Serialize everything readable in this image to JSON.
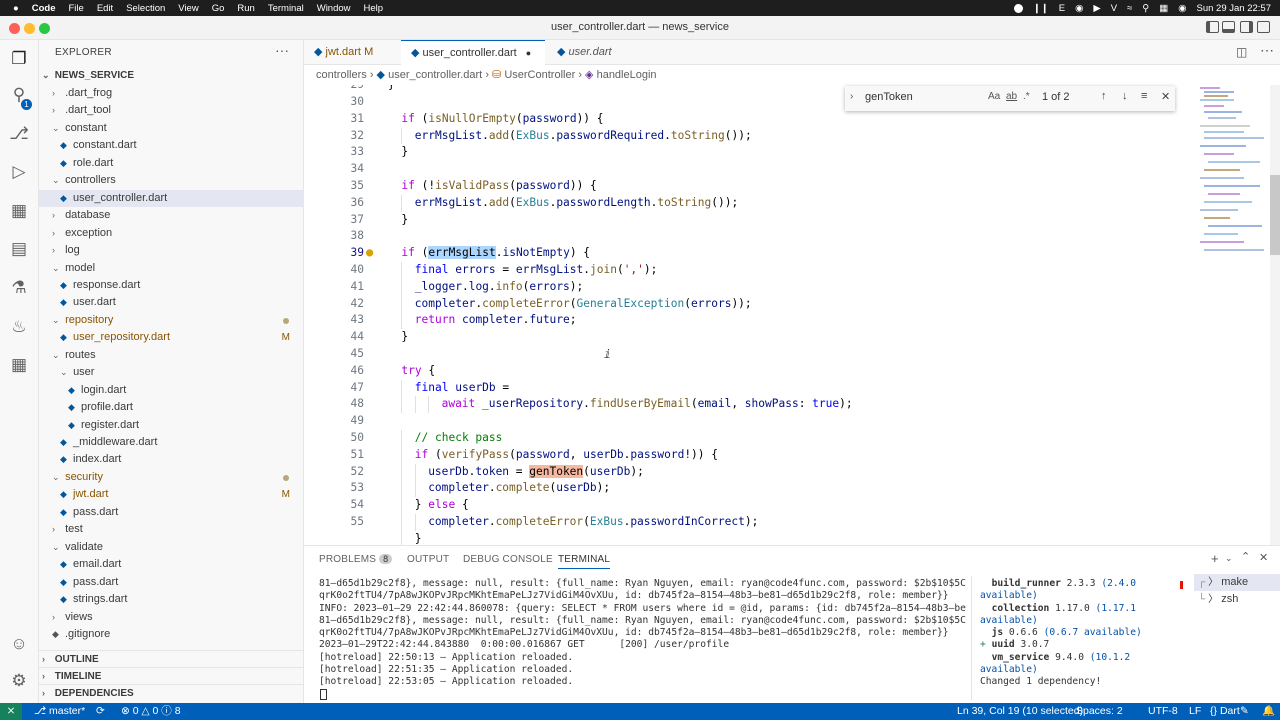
{
  "menubar": {
    "apple": "",
    "app": "Code",
    "items": [
      "File",
      "Edit",
      "Selection",
      "View",
      "Go",
      "Run",
      "Terminal",
      "Window",
      "Help"
    ],
    "clock": "Sun 29 Jan  22:57"
  },
  "window": {
    "title": "user_controller.dart — news_service"
  },
  "activity": {
    "explorer_badge": "1"
  },
  "sidebar": {
    "title": "EXPLORER",
    "more": "···",
    "root": "NEWS_SERVICE",
    "tree": [
      {
        "label": ".dart_frog",
        "depth": 1,
        "kind": "folder",
        "open": false
      },
      {
        "label": ".dart_tool",
        "depth": 1,
        "kind": "folder",
        "open": false
      },
      {
        "label": "constant",
        "depth": 1,
        "kind": "folder",
        "open": true
      },
      {
        "label": "constant.dart",
        "depth": 2,
        "kind": "file"
      },
      {
        "label": "role.dart",
        "depth": 2,
        "kind": "file"
      },
      {
        "label": "controllers",
        "depth": 1,
        "kind": "folder",
        "open": true
      },
      {
        "label": "user_controller.dart",
        "depth": 2,
        "kind": "file",
        "selected": true
      },
      {
        "label": "database",
        "depth": 1,
        "kind": "folder",
        "open": false
      },
      {
        "label": "exception",
        "depth": 1,
        "kind": "folder",
        "open": false
      },
      {
        "label": "log",
        "depth": 1,
        "kind": "folder",
        "open": false
      },
      {
        "label": "model",
        "depth": 1,
        "kind": "folder",
        "open": true
      },
      {
        "label": "response.dart",
        "depth": 2,
        "kind": "file"
      },
      {
        "label": "user.dart",
        "depth": 2,
        "kind": "file"
      },
      {
        "label": "repository",
        "depth": 1,
        "kind": "folder",
        "open": true,
        "modified": true,
        "dot": true
      },
      {
        "label": "user_repository.dart",
        "depth": 2,
        "kind": "file",
        "modified": true,
        "badge": "M"
      },
      {
        "label": "routes",
        "depth": 1,
        "kind": "folder",
        "open": true
      },
      {
        "label": "user",
        "depth": 2,
        "kind": "folder",
        "open": true
      },
      {
        "label": "login.dart",
        "depth": 3,
        "kind": "file"
      },
      {
        "label": "profile.dart",
        "depth": 3,
        "kind": "file"
      },
      {
        "label": "register.dart",
        "depth": 3,
        "kind": "file"
      },
      {
        "label": "_middleware.dart",
        "depth": 2,
        "kind": "file"
      },
      {
        "label": "index.dart",
        "depth": 2,
        "kind": "file"
      },
      {
        "label": "security",
        "depth": 1,
        "kind": "folder",
        "open": true,
        "modified": true,
        "dot": true
      },
      {
        "label": "jwt.dart",
        "depth": 2,
        "kind": "file",
        "modified": true,
        "badge": "M"
      },
      {
        "label": "pass.dart",
        "depth": 2,
        "kind": "file"
      },
      {
        "label": "test",
        "depth": 1,
        "kind": "folder",
        "open": false
      },
      {
        "label": "validate",
        "depth": 1,
        "kind": "folder",
        "open": true
      },
      {
        "label": "email.dart",
        "depth": 2,
        "kind": "file"
      },
      {
        "label": "pass.dart",
        "depth": 2,
        "kind": "file"
      },
      {
        "label": "strings.dart",
        "depth": 2,
        "kind": "file"
      },
      {
        "label": "views",
        "depth": 1,
        "kind": "folder",
        "open": false
      },
      {
        "label": ".gitignore",
        "depth": 1,
        "kind": "gitfile"
      }
    ],
    "sections": [
      "OUTLINE",
      "TIMELINE",
      "DEPENDENCIES"
    ]
  },
  "tabs": [
    {
      "label": "jwt.dart",
      "badge": "M"
    },
    {
      "label": "user_controller.dart",
      "dirty": true
    },
    {
      "label": "user.dart"
    }
  ],
  "breadcrumb": [
    "controllers",
    "user_controller.dart",
    "UserController",
    "handleLogin"
  ],
  "find": {
    "query": "genToken",
    "count": "1 of 2",
    "opt_case": "Aa",
    "opt_word": "ab",
    "opt_regex": ".*"
  },
  "code": {
    "first_partial": "29",
    "lines": [
      {
        "n": "30",
        "indent": 0,
        "segs": []
      },
      {
        "n": "31",
        "indent": 1,
        "segs": [
          [
            "k",
            "if"
          ],
          [
            "p",
            " ("
          ],
          [
            "f",
            "isNullOrEmpty"
          ],
          [
            "p",
            "("
          ],
          [
            "v",
            "password"
          ],
          [
            "p",
            ")) {"
          ]
        ]
      },
      {
        "n": "32",
        "indent": 2,
        "segs": [
          [
            "v",
            "errMsgList"
          ],
          [
            "p",
            "."
          ],
          [
            "f",
            "add"
          ],
          [
            "p",
            "("
          ],
          [
            "t",
            "ExBus"
          ],
          [
            "p",
            "."
          ],
          [
            "v",
            "passwordRequired"
          ],
          [
            "p",
            "."
          ],
          [
            "f",
            "toString"
          ],
          [
            "p",
            "());"
          ]
        ]
      },
      {
        "n": "33",
        "indent": 1,
        "segs": [
          [
            "p",
            "}"
          ]
        ]
      },
      {
        "n": "34",
        "indent": 0,
        "segs": []
      },
      {
        "n": "35",
        "indent": 1,
        "segs": [
          [
            "k",
            "if"
          ],
          [
            "p",
            " (!"
          ],
          [
            "f",
            "isValidPass"
          ],
          [
            "p",
            "("
          ],
          [
            "v",
            "password"
          ],
          [
            "p",
            ")) {"
          ]
        ]
      },
      {
        "n": "36",
        "indent": 2,
        "segs": [
          [
            "v",
            "errMsgList"
          ],
          [
            "p",
            "."
          ],
          [
            "f",
            "add"
          ],
          [
            "p",
            "("
          ],
          [
            "t",
            "ExBus"
          ],
          [
            "p",
            "."
          ],
          [
            "v",
            "passwordLength"
          ],
          [
            "p",
            "."
          ],
          [
            "f",
            "toString"
          ],
          [
            "p",
            "());"
          ]
        ]
      },
      {
        "n": "37",
        "indent": 1,
        "segs": [
          [
            "p",
            "}"
          ]
        ]
      },
      {
        "n": "38",
        "indent": 0,
        "segs": []
      },
      {
        "n": "39",
        "indent": 1,
        "current": true,
        "segs": [
          [
            "k",
            "if"
          ],
          [
            "p",
            " ("
          ],
          [
            "hl",
            "errMsgList"
          ],
          [
            "p",
            "."
          ],
          [
            "v",
            "isNotEmpty"
          ],
          [
            "p",
            ") {"
          ]
        ]
      },
      {
        "n": "40",
        "indent": 2,
        "segs": [
          [
            "kb",
            "final"
          ],
          [
            "p",
            " "
          ],
          [
            "v",
            "errors"
          ],
          [
            "p",
            " = "
          ],
          [
            "v",
            "errMsgList"
          ],
          [
            "p",
            "."
          ],
          [
            "f",
            "join"
          ],
          [
            "p",
            "("
          ],
          [
            "s",
            "','"
          ],
          [
            "p",
            ");"
          ]
        ]
      },
      {
        "n": "41",
        "indent": 2,
        "segs": [
          [
            "v",
            "_logger"
          ],
          [
            "p",
            "."
          ],
          [
            "v",
            "log"
          ],
          [
            "p",
            "."
          ],
          [
            "f",
            "info"
          ],
          [
            "p",
            "("
          ],
          [
            "v",
            "errors"
          ],
          [
            "p",
            ");"
          ]
        ]
      },
      {
        "n": "42",
        "indent": 2,
        "segs": [
          [
            "v",
            "completer"
          ],
          [
            "p",
            "."
          ],
          [
            "f",
            "completeError"
          ],
          [
            "p",
            "("
          ],
          [
            "t",
            "GeneralException"
          ],
          [
            "p",
            "("
          ],
          [
            "v",
            "errors"
          ],
          [
            "p",
            "));"
          ]
        ]
      },
      {
        "n": "43",
        "indent": 2,
        "segs": [
          [
            "k",
            "return"
          ],
          [
            "p",
            " "
          ],
          [
            "v",
            "completer"
          ],
          [
            "p",
            "."
          ],
          [
            "v",
            "future"
          ],
          [
            "p",
            ";"
          ]
        ]
      },
      {
        "n": "44",
        "indent": 1,
        "segs": [
          [
            "p",
            "}"
          ]
        ]
      },
      {
        "n": "45",
        "indent": 0,
        "segs": []
      },
      {
        "n": "46",
        "indent": 1,
        "segs": [
          [
            "k",
            "try"
          ],
          [
            "p",
            " {"
          ]
        ]
      },
      {
        "n": "47",
        "indent": 2,
        "segs": [
          [
            "kb",
            "final"
          ],
          [
            "p",
            " "
          ],
          [
            "v",
            "userDb"
          ],
          [
            "p",
            " ="
          ]
        ]
      },
      {
        "n": "48",
        "indent": 4,
        "segs": [
          [
            "k",
            "await"
          ],
          [
            "p",
            " "
          ],
          [
            "v",
            "_userRepository"
          ],
          [
            "p",
            "."
          ],
          [
            "f",
            "findUserByEmail"
          ],
          [
            "p",
            "("
          ],
          [
            "v",
            "email"
          ],
          [
            "p",
            ", "
          ],
          [
            "v",
            "showPass"
          ],
          [
            "p",
            ": "
          ],
          [
            "kb",
            "true"
          ],
          [
            "p",
            ");"
          ]
        ]
      },
      {
        "n": "49",
        "indent": 0,
        "segs": []
      },
      {
        "n": "50",
        "indent": 2,
        "segs": [
          [
            "c",
            "// check pass"
          ]
        ]
      },
      {
        "n": "51",
        "indent": 2,
        "segs": [
          [
            "k",
            "if"
          ],
          [
            "p",
            " ("
          ],
          [
            "f",
            "verifyPass"
          ],
          [
            "p",
            "("
          ],
          [
            "v",
            "password"
          ],
          [
            "p",
            ", "
          ],
          [
            "v",
            "userDb"
          ],
          [
            "p",
            "."
          ],
          [
            "v",
            "password"
          ],
          [
            "p",
            "!)) {"
          ]
        ]
      },
      {
        "n": "52",
        "indent": 3,
        "segs": [
          [
            "v",
            "userDb"
          ],
          [
            "p",
            "."
          ],
          [
            "v",
            "token"
          ],
          [
            "p",
            " = "
          ],
          [
            "fm",
            "genToken"
          ],
          [
            "p",
            "("
          ],
          [
            "v",
            "userDb"
          ],
          [
            "p",
            ");"
          ]
        ]
      },
      {
        "n": "53",
        "indent": 3,
        "segs": [
          [
            "v",
            "completer"
          ],
          [
            "p",
            "."
          ],
          [
            "f",
            "complete"
          ],
          [
            "p",
            "("
          ],
          [
            "v",
            "userDb"
          ],
          [
            "p",
            ");"
          ]
        ]
      },
      {
        "n": "54",
        "indent": 2,
        "segs": [
          [
            "p",
            "} "
          ],
          [
            "k",
            "else"
          ],
          [
            "p",
            " {"
          ]
        ]
      },
      {
        "n": "55",
        "indent": 3,
        "segs": [
          [
            "v",
            "completer"
          ],
          [
            "p",
            "."
          ],
          [
            "f",
            "completeError"
          ],
          [
            "p",
            "("
          ],
          [
            "t",
            "ExBus"
          ],
          [
            "p",
            "."
          ],
          [
            "v",
            "passwordInCorrect"
          ],
          [
            "p",
            ");"
          ]
        ]
      },
      {
        "n": "",
        "indent": 2,
        "segs": [
          [
            "p",
            "}"
          ]
        ]
      }
    ]
  },
  "panel": {
    "tabs": [
      {
        "label": "PROBLEMS",
        "badge": "8"
      },
      {
        "label": "OUTPUT"
      },
      {
        "label": "DEBUG CONSOLE"
      },
      {
        "label": "TERMINAL",
        "active": true
      }
    ],
    "terminal_lines": [
      "81–d65d1b29c2f8}, message: null, result: {full_name: Ryan Nguyen, email: ryan@code4func.com, password: $2b$10$5C",
      "qrK0o2ftTU4/7pA8wJKOPvJRpcMKhtEmaPeLJz7VidGiM4OvXUu, id: db745f2a–8154–48b3–be81–d65d1b29c2f8, role: member}}",
      "INFO: 2023–01–29 22:42:44.860078: {query: SELECT * FROM users where id = @id, params: {id: db745f2a–8154–48b3–be",
      "81–d65d1b29c2f8}, message: null, result: {full_name: Ryan Nguyen, email: ryan@code4func.com, password: $2b$10$5C",
      "qrK0o2ftTU4/7pA8wJKOPvJRpcMKhtEmaPeLJz7VidGiM4OvXUu, id: db745f2a–8154–48b3–be81–d65d1b29c2f8, role: member}}",
      "2023–01–29T22:42:44.843880  0:00:00.016867 GET      [200] /user/profile",
      "[hotreload] 22:50:13 – Application reloaded.",
      "[hotreload] 22:51:35 – Application reloaded.",
      "[hotreload] 22:53:05 – Application reloaded."
    ],
    "deps": [
      {
        "prefix": "  ",
        "name": "build_runner",
        "ver": "2.3.3",
        "avail": "(2.4.0 available)"
      },
      {
        "prefix": "  ",
        "name": "collection",
        "ver": "1.17.0",
        "avail": "(1.17.1 available)"
      },
      {
        "prefix": "  ",
        "name": "js",
        "ver": "0.6.6",
        "avail": "(0.6.7 available)"
      },
      {
        "prefix": "+ ",
        "name": "uuid",
        "ver": "3.0.7",
        "avail": ""
      },
      {
        "prefix": "  ",
        "name": "vm_service",
        "ver": "9.4.0",
        "avail": "(10.1.2 available)"
      }
    ],
    "deps_footer": "Changed 1 dependency!",
    "terminals": [
      "make",
      "zsh"
    ]
  },
  "status": {
    "remote": "⨯",
    "branch": "master*",
    "sync": "⟳",
    "errors": "0",
    "warnings": "0",
    "infos": "8",
    "position": "Ln 39, Col 19 (10 selected)",
    "spaces": "Spaces: 2",
    "encoding": "UTF-8",
    "eol": "LF",
    "language": "Dart"
  },
  "colors": {
    "accent": "#005fb8",
    "menubar": "#1e1e1e",
    "modified": "#895503",
    "find_match": "#f6b8a0",
    "selection": "#add6ff"
  }
}
